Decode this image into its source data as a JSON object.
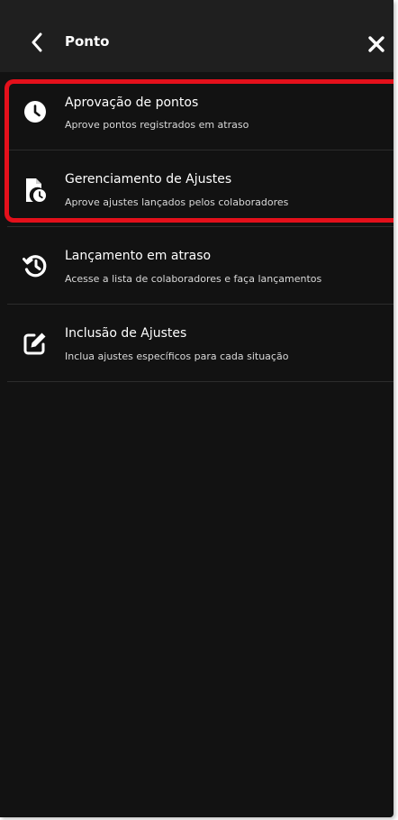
{
  "header": {
    "title": "Ponto",
    "back_icon": "chevron-left-icon",
    "close_icon": "close-icon"
  },
  "menu": {
    "items": [
      {
        "label": "Aprovação de pontos",
        "description": "Aprove pontos registrados em atraso",
        "icon": "clock-icon"
      },
      {
        "label": "Gerenciamento de Ajustes",
        "description": "Aprove ajustes lançados pelos colaboradores",
        "icon": "file-clock-icon"
      },
      {
        "label": "Lançamento em atraso",
        "description": "Acesse a lista de colaboradores e faça lançamentos",
        "icon": "history-icon"
      },
      {
        "label": "Inclusão de Ajustes",
        "description": "Inclua ajustes específicos para cada situação",
        "icon": "edit-icon"
      }
    ]
  },
  "colors": {
    "background": "#121212",
    "header": "#1f1f1f",
    "highlight": "#e4101b",
    "text": "#ffffff"
  }
}
